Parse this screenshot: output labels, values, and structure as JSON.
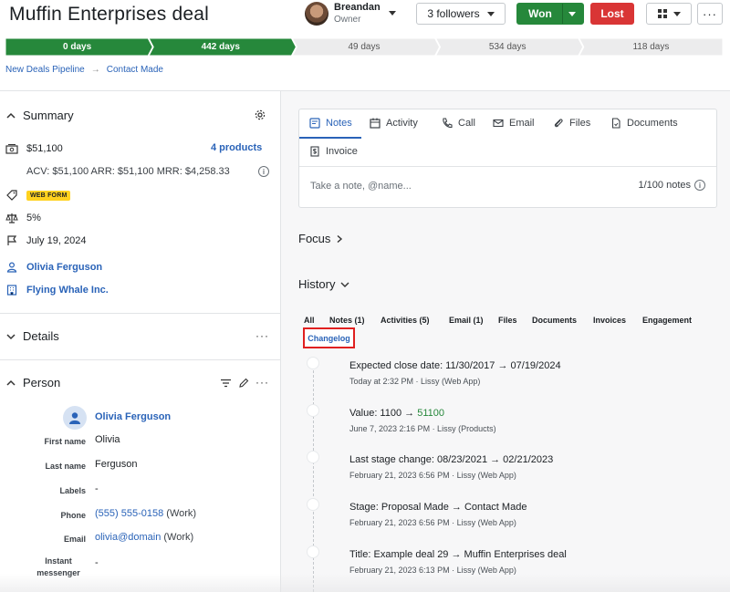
{
  "deal": {
    "title": "Muffin Enterprises deal"
  },
  "owner": {
    "name": "Breandan",
    "role": "Owner"
  },
  "toolbar": {
    "followers_label": "3 followers",
    "won_label": "Won",
    "lost_label": "Lost",
    "more_label": "···"
  },
  "pipeline": {
    "stages": [
      {
        "label": "0 days",
        "status": "done"
      },
      {
        "label": "442 days",
        "status": "done"
      },
      {
        "label": "49 days",
        "status": "todo"
      },
      {
        "label": "534 days",
        "status": "todo"
      },
      {
        "label": "118 days",
        "status": "todo"
      }
    ]
  },
  "breadcrumb": {
    "pipeline": "New Deals Pipeline",
    "stage": "Contact Made"
  },
  "summary": {
    "title": "Summary",
    "value": "$51,100",
    "products": "4 products",
    "recurring": "ACV: $51,100  ARR: $51,100  MRR: $4,258.33",
    "source_badge": "WEB FORM",
    "probability": "5%",
    "close_date": "July 19, 2024",
    "person": "Olivia Ferguson",
    "organization": "Flying Whale Inc."
  },
  "details": {
    "title": "Details"
  },
  "person": {
    "title": "Person",
    "name": "Olivia Ferguson",
    "fields": [
      {
        "label": "First name",
        "value": "Olivia"
      },
      {
        "label": "Last name",
        "value": "Ferguson"
      },
      {
        "label": "Labels",
        "value": "-"
      },
      {
        "label": "Phone",
        "value": "(555) 555-0158",
        "note": "(Work)"
      },
      {
        "label": "Email",
        "value": "olivia@domain",
        "note": "(Work)"
      },
      {
        "label": "Instant messenger",
        "value": "-"
      }
    ]
  },
  "composer": {
    "tabs": [
      "Notes",
      "Activity",
      "Call",
      "Email",
      "Files",
      "Documents",
      "Invoice"
    ],
    "placeholder": "Take a note, @name...",
    "count": "1/100 notes"
  },
  "focus": {
    "title": "Focus"
  },
  "history": {
    "title": "History",
    "tabs": [
      "All",
      "Notes (1)",
      "Activities (5)",
      "Email (1)",
      "Files",
      "Documents",
      "Invoices",
      "Engagement"
    ],
    "active_tab": "Changelog",
    "items": [
      {
        "main": "Expected close date: 11/30/2017 → 07/19/2024",
        "sub": "Today at 2:32 PM · Lissy (Web App)"
      },
      {
        "main_prefix": "Value: 1100 → ",
        "main_highlight": "51100",
        "sub": "June 7, 2023 2:16 PM · Lissy (Products)"
      },
      {
        "main": "Last stage change: 08/23/2021 → 02/21/2023",
        "sub": "February 21, 2023 6:56 PM · Lissy (Web App)"
      },
      {
        "main": "Stage: Proposal Made → Contact Made",
        "sub": "February 21, 2023 6:56 PM · Lissy (Web App)"
      },
      {
        "main": "Title: Example deal 29 → Muffin Enterprises deal",
        "sub": "February 21, 2023 6:13 PM · Lissy (Web App)"
      }
    ]
  },
  "colors": {
    "accent": "#2a63b8",
    "won": "#26883b",
    "lost": "#d93535",
    "badge": "#ffd21f"
  }
}
